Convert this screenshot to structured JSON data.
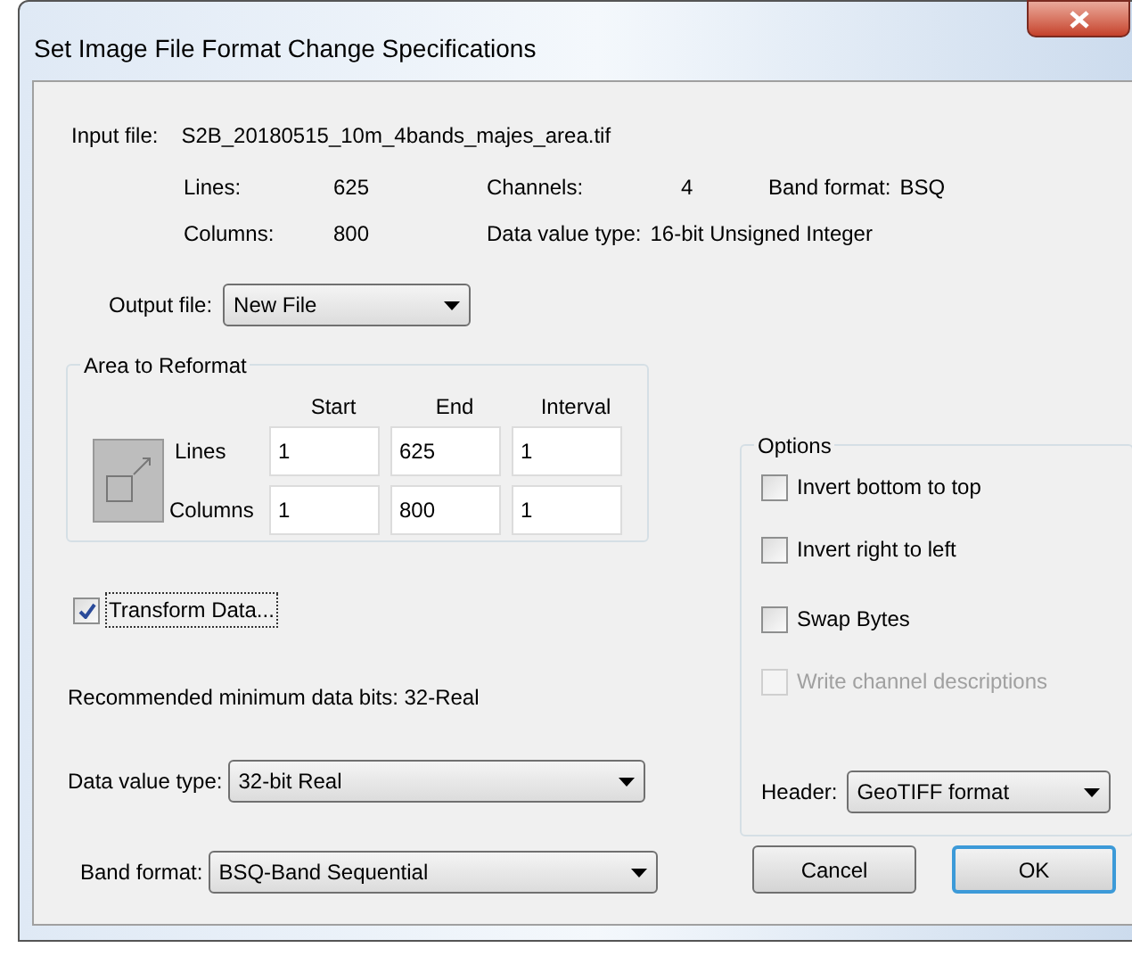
{
  "window": {
    "title": "Set Image File Format Change Specifications"
  },
  "input_file": {
    "label": "Input file:",
    "value": "S2B_20180515_10m_4bands_majes_area.tif"
  },
  "info_rows": [
    [
      {
        "label": "Lines:",
        "value": "625"
      },
      {
        "label": "Channels:",
        "value": "4"
      },
      {
        "label": "Band format:",
        "value": "BSQ"
      }
    ],
    [
      {
        "label": "Columns:",
        "value": "800"
      },
      {
        "label": "Data value type:",
        "value": "16-bit Unsigned Integer"
      }
    ]
  ],
  "output_file": {
    "label": "Output file:",
    "value": "New File"
  },
  "area": {
    "title": "Area to Reformat",
    "columns": [
      "Start",
      "End",
      "Interval"
    ],
    "rows": [
      {
        "label": "Lines",
        "values": [
          "1",
          "625",
          "1"
        ]
      },
      {
        "label": "Columns",
        "values": [
          "1",
          "800",
          "1"
        ]
      }
    ]
  },
  "transform": {
    "label": "Transform Data...",
    "checked": true
  },
  "recommended": "Recommended minimum data bits: 32-Real",
  "data_value_type": {
    "label": "Data value type:",
    "value": "32-bit Real"
  },
  "band_format": {
    "label": "Band format:",
    "value": "BSQ-Band Sequential"
  },
  "options": {
    "title": "Options",
    "items": [
      {
        "label": "Invert bottom to top",
        "checked": false,
        "disabled": false
      },
      {
        "label": "Invert right to left",
        "checked": false,
        "disabled": false
      },
      {
        "label": "Swap Bytes",
        "checked": false,
        "disabled": false
      },
      {
        "label": "Write channel descriptions",
        "checked": false,
        "disabled": true
      }
    ],
    "header": {
      "label": "Header:",
      "value": "GeoTIFF format"
    }
  },
  "buttons": [
    {
      "label": "Cancel",
      "default": false
    },
    {
      "label": "OK",
      "default": true
    }
  ]
}
